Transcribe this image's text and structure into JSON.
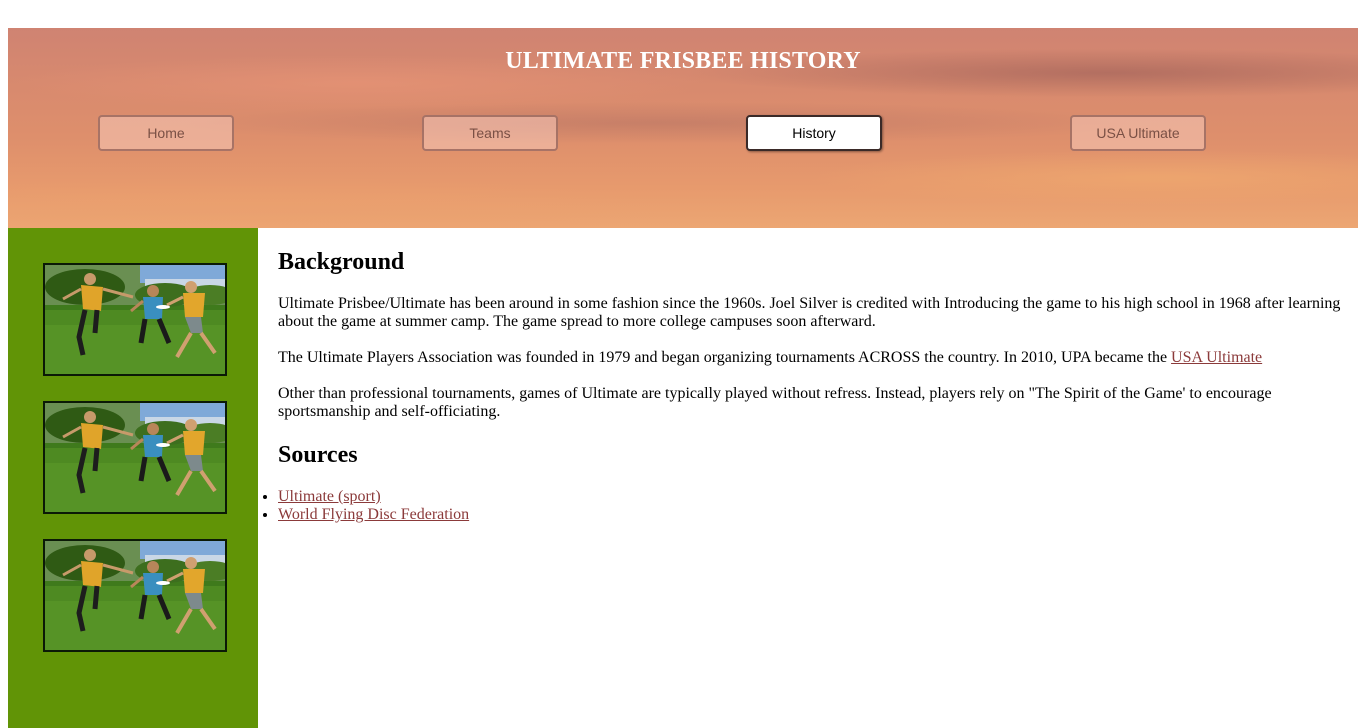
{
  "header": {
    "title": "ULTIMATE FRISBEE HISTORY",
    "nav": [
      {
        "label": "Home",
        "active": false
      },
      {
        "label": "Teams",
        "active": false
      },
      {
        "label": "History",
        "active": true
      },
      {
        "label": "USA Ultimate",
        "active": false
      }
    ]
  },
  "sidebar": {
    "image_count": 3,
    "image_subject": "ultimate-frisbee-players-photo",
    "background_color": "#619406"
  },
  "main": {
    "background": {
      "heading": "Background",
      "paragraphs": [
        "Ultimate Prisbee/Ultimate has been around in some fashion since the 1960s. Joel Silver is credited with Introducing the game to his high school in 1968 after learning about the game at summer camp. The game spread to more college campuses soon afterward.",
        "The Ultimate Players Association was founded in 1979 and began organizing tournaments ACROSS the country. In 2010, UPA became the",
        "Other than professional tournaments, games of Ultimate are typically played without refress. Instead, players rely on \"The Spirit of the Game' to encourage sportsmanship and self-officiating."
      ],
      "inline_link": "USA Ultimate"
    },
    "sources": {
      "heading": "Sources",
      "links": [
        "Ultimate (sport)",
        "World Flying Disc Federation"
      ]
    }
  },
  "colors": {
    "link": "#8b3a3a",
    "sidebar": "#619406",
    "title_text": "#ffffff"
  }
}
